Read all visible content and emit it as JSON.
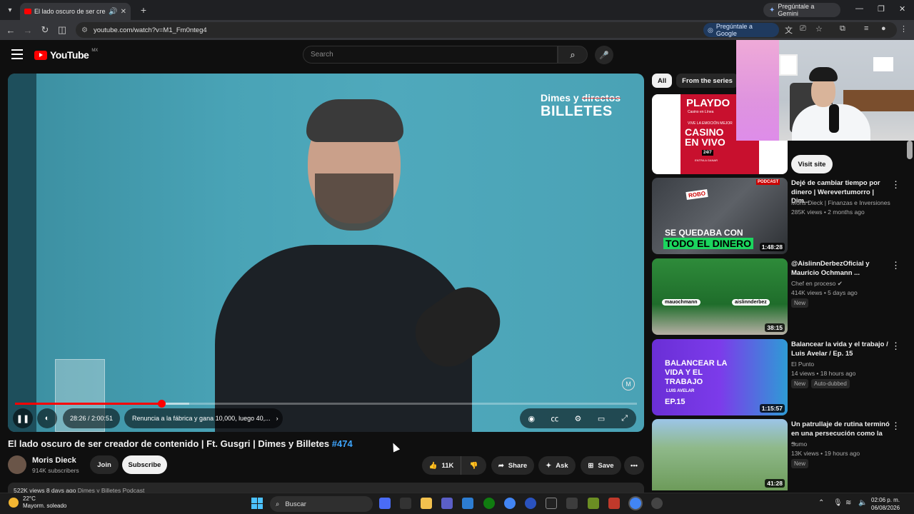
{
  "browser": {
    "tab_title": "El lado oscuro de ser creador de contenido",
    "new_tab": "+",
    "gemini_label": "Pregúntale a Gemini",
    "url": "youtube.com/watch?v=M1_Fm0nteg4",
    "ask_google_label": "Pregúntale a Google"
  },
  "youtube": {
    "logo_text": "YouTube",
    "country_code": "MX",
    "search_placeholder": "Search"
  },
  "player": {
    "brand_line1_a": "Dimes y",
    "brand_line1_b": "directos",
    "brand_line2": "BILLETES",
    "watermark": "M",
    "time": "28:26 / 2:00:51",
    "chapter": "Renuncia a la fábrica y gana 10,000, luego 40,...",
    "played_fraction": 0.2356,
    "buffered_fraction": 0.28
  },
  "video": {
    "title": "El lado oscuro de ser creador de contenido | Ft. Gusgri | Dimes y Billetes",
    "hashtag": "#474",
    "channel": "Moris Dieck",
    "subscribers": "914K subscribers",
    "join": "Join",
    "subscribe": "Subscribe",
    "likes": "11K",
    "share": "Share",
    "ask": "Ask",
    "save": "Save",
    "desc_stats": "522K views  8 days ago",
    "desc_tag": "Dimes y Billetes Podcast"
  },
  "sidebar": {
    "chips": [
      "All",
      "From the series"
    ],
    "ad": {
      "brand": "PLAYDO",
      "sub": "Casino en Línea",
      "tagline": "VIVE LA EMOCIÓN  MEJOR",
      "headline": "CASINO EN VIVO",
      "hours": "24/7",
      "cta": "ENTRA A GANAR",
      "visit_label": "Visit site"
    },
    "recs": [
      {
        "title": "Dejé de cambiar tiempo por dinero | Werevertumorro | Dim...",
        "channel": "Moris Dieck | Finanzas e Inversiones",
        "meta": "285K views • 2 months ago",
        "duration": "1:48:28",
        "thumb_line1": "SE QUEDABA CON",
        "thumb_line2": "TODO EL DINERO",
        "thumb_tag": "PODCAST",
        "thumb_small": "ROBO",
        "badges": []
      },
      {
        "title": "@AislinnDerbezOficial y Mauricio Ochmann ...",
        "channel": "Chef en proceso",
        "meta": "414K views • 5 days ago",
        "duration": "38:15",
        "thumb_line1": "mauochmann",
        "thumb_line2": "aislinnderbez",
        "badges": [
          "New"
        ]
      },
      {
        "title": "Balancear la vida y el trabajo / Luis Avelar / Ep. 15",
        "channel": "El Punto",
        "meta": "14 views • 18 hours ago",
        "duration": "1:15:57",
        "thumb_line1": "BALANCEAR LA VIDA Y EL TRABAJO",
        "thumb_line2": "LUIS AVELAR",
        "thumb_ep": "EP.15",
        "badges": [
          "New",
          "Auto-dubbed"
        ]
      },
      {
        "title": "Un patrullaje de rutina terminó en una persecución como la ...",
        "channel": "Sumo",
        "meta": "13K views • 19 hours ago",
        "duration": "41:28",
        "badges": [
          "New"
        ]
      }
    ]
  },
  "taskbar": {
    "temp": "22°C",
    "weather": "Mayorm. soleado",
    "search": "Buscar",
    "time": "02:06 p. m.",
    "date": "06/08/2026"
  },
  "colors": {
    "youtube_red": "#ff0000",
    "link_blue": "#3ea6ff",
    "background": "#0f0f0f"
  }
}
